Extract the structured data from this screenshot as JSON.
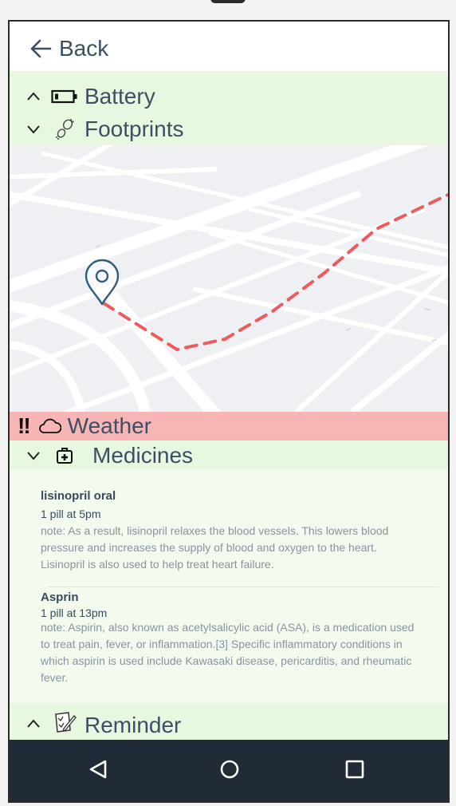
{
  "topbar": {
    "back_label": "Back"
  },
  "sections": {
    "battery": {
      "label": "Battery",
      "expanded": true
    },
    "footprints": {
      "label": "Footprints",
      "expanded": false
    },
    "weather": {
      "label": "Weather",
      "alert": "!!",
      "color": "#f8b5b5"
    },
    "medicines": {
      "label": "Medicines",
      "expanded": false
    },
    "reminder": {
      "label": "Reminder",
      "expanded": true
    }
  },
  "medicines": [
    {
      "name": "lisinopril oral",
      "dose": "1 pill at 5pm",
      "note": "note: As a result, lisinopril relaxes the blood vessels. This lowers blood pressure and increases the supply of blood and oxygen to the heart. Lisinopril is also used to help treat heart failure."
    },
    {
      "name": "Asprin",
      "dose": "1 pill at 13pm",
      "note": "note: Aspirin, also known as acetylsalicylic acid (ASA), is a medication used to treat pain, fever, or inflammation.[3] Specific inflammatory conditions in which aspirin is used include Kawasaki disease, pericarditis, and rheumatic fever."
    }
  ],
  "colors": {
    "section_green": "#e8f8e0",
    "alert_red": "#f8b5b5",
    "route": "#ef5a5f",
    "pin": "#2e5d7e",
    "navbar": "#212b38"
  },
  "icons": {
    "back": "arrow-left-icon",
    "battery": "battery-icon",
    "footprints": "footprints-icon",
    "weather": "cloud-icon",
    "medicines": "medical-kit-icon",
    "reminder": "checklist-icon",
    "map_pin": "location-pin-icon",
    "nav_back": "triangle-back-icon",
    "nav_home": "circle-home-icon",
    "nav_recents": "square-recents-icon"
  }
}
